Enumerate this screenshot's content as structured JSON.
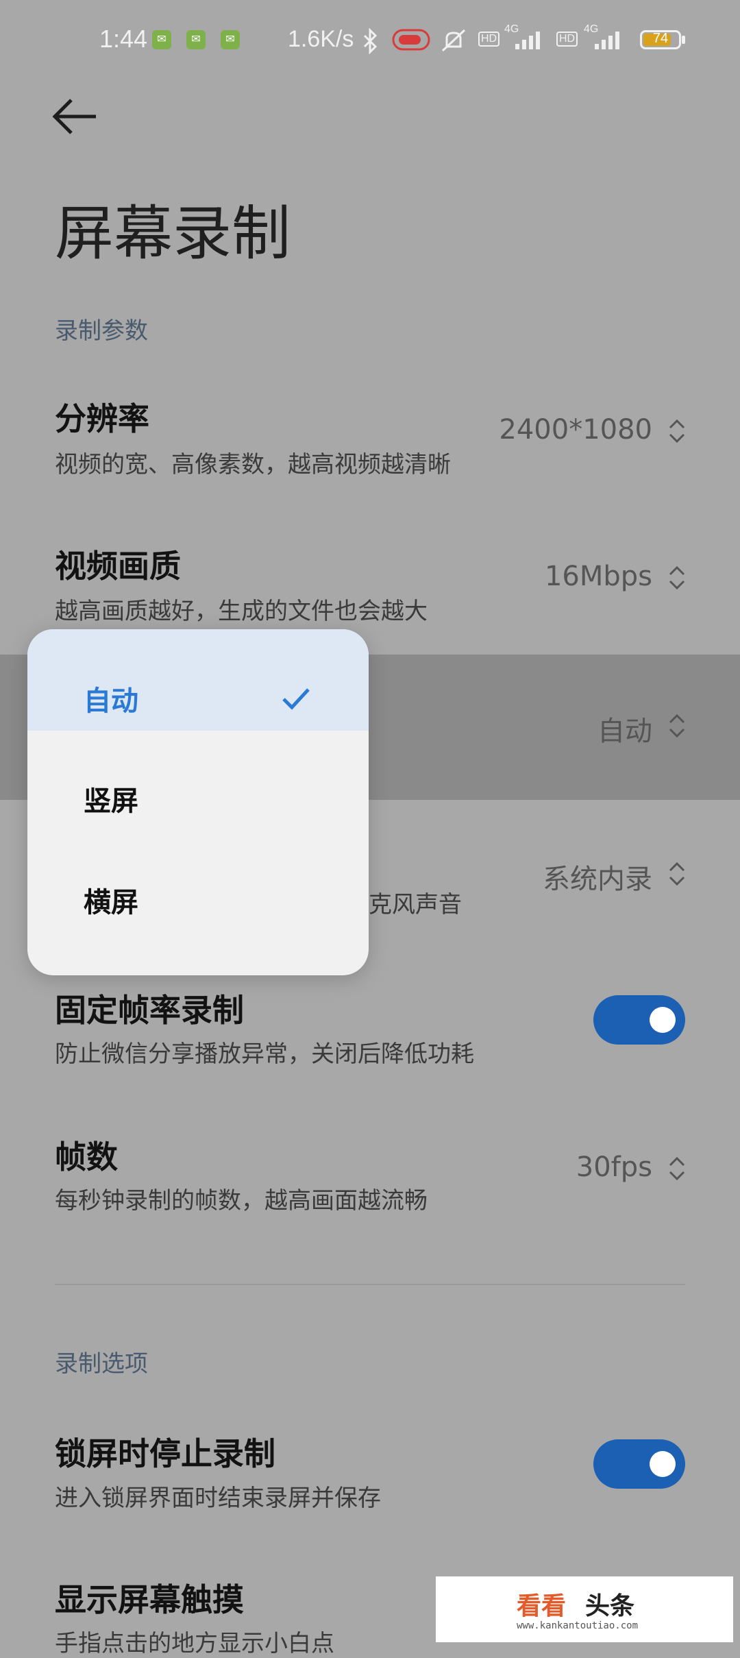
{
  "status_bar": {
    "time": "1:44",
    "net_speed": "1.6K/s",
    "battery_level": "74",
    "icons": [
      "wechat-icon",
      "wechat-icon",
      "wechat-icon",
      "bluetooth-icon",
      "record-indicator-icon",
      "mute-icon",
      "hd-icon",
      "signal-4g-icon",
      "hd-icon",
      "signal-4g-icon",
      "battery-icon"
    ],
    "hd_label": "HD",
    "network_label": "4G"
  },
  "page": {
    "title": "屏幕录制",
    "back_icon": "arrow-left-icon"
  },
  "sections": {
    "params": "录制参数",
    "options": "录制选项"
  },
  "rows": {
    "resolution": {
      "title": "分辨率",
      "subtitle": "视频的宽、高像素数，越高视频越清晰",
      "value": "2400*1080"
    },
    "quality": {
      "title": "视频画质",
      "subtitle": "越高画质越好，生成的文件也会越大",
      "value": "16Mbps"
    },
    "orientation": {
      "value": "自动"
    },
    "audio": {
      "value": "系统内录",
      "subtitle_partial": "克风声音"
    },
    "fixed_fps": {
      "title": "固定帧率录制",
      "subtitle": "防止微信分享播放异常，关闭后降低功耗",
      "enabled": true
    },
    "fps": {
      "title": "帧数",
      "subtitle": "每秒钟录制的帧数，越高画面越流畅",
      "value": "30fps"
    },
    "lock_stop": {
      "title": "锁屏时停止录制",
      "subtitle": "进入锁屏界面时结束录屏并保存",
      "enabled": true
    },
    "show_touch": {
      "title": "显示屏幕触摸",
      "subtitle": "手指点击的地方显示小白点"
    }
  },
  "popup": {
    "options": [
      {
        "label": "自动",
        "selected": true
      },
      {
        "label": "竖屏",
        "selected": false
      },
      {
        "label": "横屏",
        "selected": false
      }
    ]
  },
  "watermark": {
    "brand": "看看",
    "brand2": "头条",
    "url": "www.kankantoutiao.com"
  },
  "colors": {
    "accent": "#2a7ad5",
    "toggle_on": "#1b60b3",
    "battery": "#d9a21d"
  }
}
